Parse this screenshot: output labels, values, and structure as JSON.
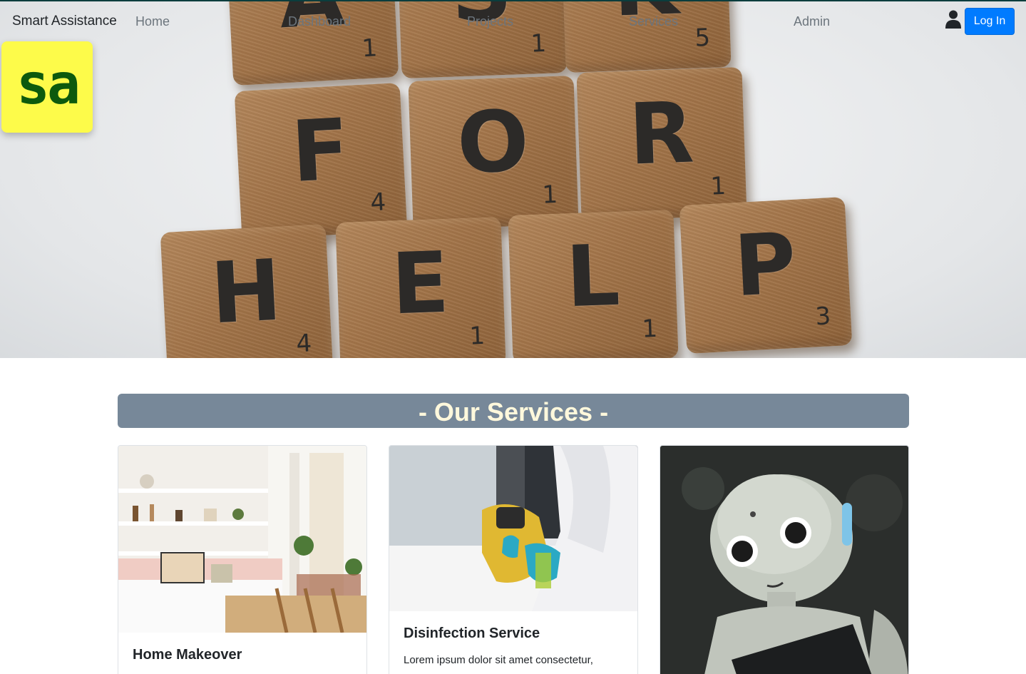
{
  "navbar": {
    "brand": "Smart Assistance",
    "links": [
      "Home",
      "Dashboard",
      "Projects",
      "Services",
      "Admin"
    ],
    "login_label": "Log In"
  },
  "logo": {
    "text": "sa",
    "background": "#fdfb4a",
    "color": "#0d5a0d"
  },
  "hero": {
    "tiles": [
      {
        "letter": "A",
        "points": "1"
      },
      {
        "letter": "S",
        "points": "1"
      },
      {
        "letter": "K",
        "points": "5"
      },
      {
        "letter": "F",
        "points": "4"
      },
      {
        "letter": "O",
        "points": "1"
      },
      {
        "letter": "R",
        "points": "1"
      },
      {
        "letter": "H",
        "points": "4"
      },
      {
        "letter": "E",
        "points": "1"
      },
      {
        "letter": "L",
        "points": "1"
      },
      {
        "letter": "P",
        "points": "3"
      }
    ]
  },
  "services": {
    "heading": "- Our Services -",
    "cards": [
      {
        "title": "Home Makeover",
        "text": ""
      },
      {
        "title": "Disinfection Service",
        "text": "Lorem ipsum dolor sit amet consectetur,"
      },
      {
        "title": "",
        "text": ""
      }
    ]
  },
  "colors": {
    "primary_button": "#007bff",
    "heading_bar": "#778899",
    "heading_text": "#fff8dc"
  }
}
